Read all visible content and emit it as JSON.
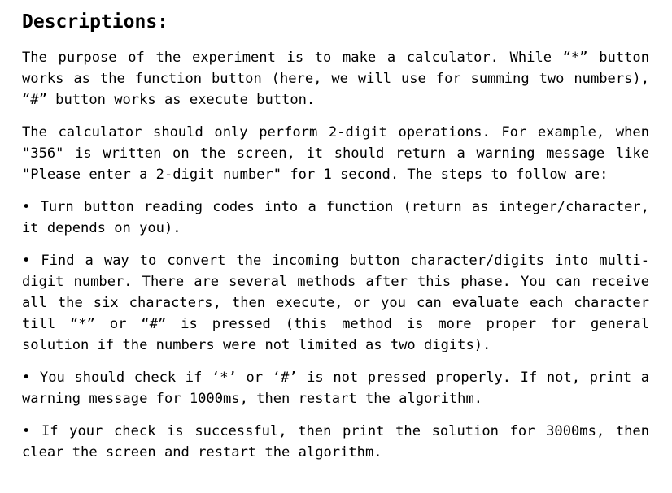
{
  "document": {
    "heading": "Descriptions:",
    "paragraphs": [
      {
        "id": "purpose",
        "kind": "paragraph",
        "text": "The purpose of the experiment is to make a calculator. While “*” button works as the function button (here, we will use for summing two numbers), “#” button works as execute button."
      },
      {
        "id": "two-digit-rule",
        "kind": "paragraph",
        "text": "The calculator should only perform 2-digit operations. For example, when \"356\" is written on the screen, it should return a warning message like \"Please enter a 2-digit number\" for 1 second. The steps to follow are:"
      },
      {
        "id": "step-read-codes",
        "kind": "bullet",
        "bullet": "•",
        "text": "Turn button reading codes into a function (return as integer/character, it depends on you)."
      },
      {
        "id": "step-convert-digits",
        "kind": "bullet",
        "bullet": "•",
        "text": "Find a way to convert the incoming button character/digits into multi-digit number. There are several methods after this phase. You can receive all the six characters, then execute, or you can evaluate each character till “*” or “#” is pressed (this method is more proper for general solution if the numbers were not limited as two digits)."
      },
      {
        "id": "step-check-keys",
        "kind": "bullet",
        "bullet": "•",
        "text": "You should check if ‘*’ or ‘#’ is not pressed properly. If not, print a warning message for 1000ms, then restart the algorithm."
      },
      {
        "id": "step-print-solution",
        "kind": "bullet",
        "bullet": "•",
        "text": "If your check is successful, then print the solution for 3000ms, then clear the screen and restart the algorithm."
      }
    ]
  },
  "style": {
    "background_color": "#ffffff",
    "text_color": "#000000"
  }
}
